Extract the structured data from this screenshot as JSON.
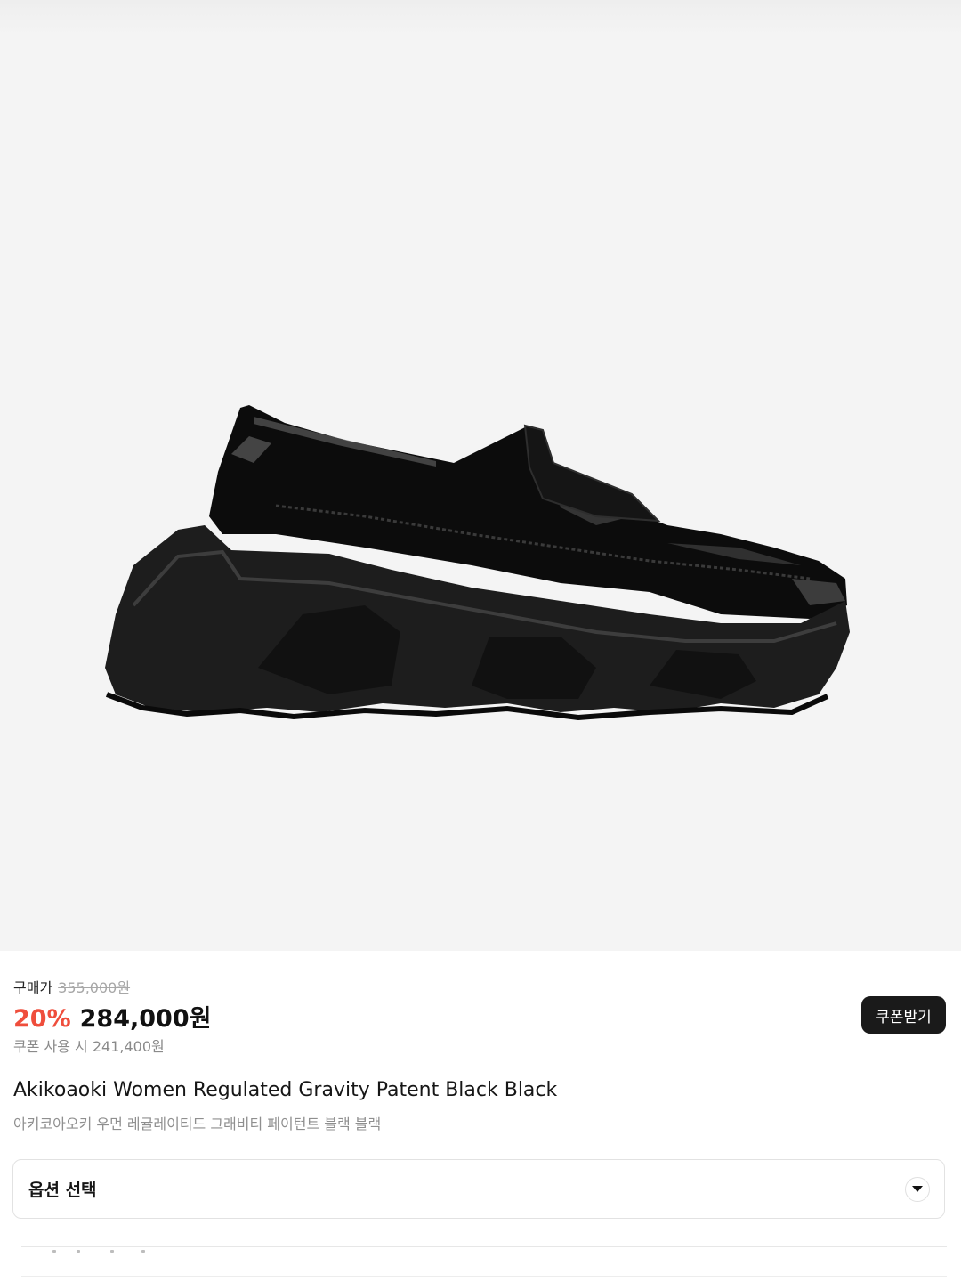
{
  "product": {
    "image_icon": "loafer-shoe-image",
    "buy_label": "구매가",
    "original_price": "355,000원",
    "discount": "20%",
    "sale_price": "284,000원",
    "coupon_price_text": "쿠폰 사용 시 241,400원",
    "coupon_button": "쿠폰받기",
    "title_en": "Akikoaoki Women Regulated Gravity Patent Black Black",
    "title_ko": "아키코아오키 우먼 레귤레이티드 그래비티 페이턴트 블랙 블랙"
  },
  "options": {
    "select_label": "옵션 선택",
    "chevron_icon": "chevron-down-icon"
  },
  "colors": {
    "discount": "#ef4e3c",
    "button_bg": "#1a1a1a",
    "hero_bg": "#f4f4f4"
  }
}
